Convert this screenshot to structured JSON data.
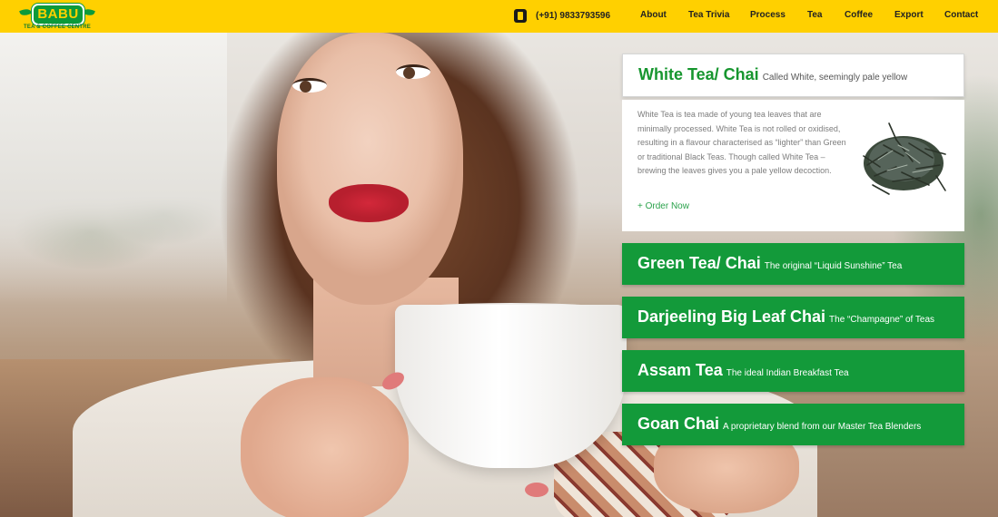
{
  "header": {
    "logo_text": "BABU",
    "logo_subtitle": "TEA & COFFEE CENTRE",
    "phone_icon": "phone-icon",
    "phone": "(+91) 9833793596",
    "nav": [
      "About",
      "Tea Trivia",
      "Process",
      "Tea",
      "Coffee",
      "Export",
      "Contact"
    ]
  },
  "colors": {
    "header_bg": "#ffd000",
    "brand_green": "#139a3a",
    "title_green": "#17962f"
  },
  "products": {
    "featured": {
      "title": "White Tea/ Chai",
      "subtitle": "Called White, seemingly pale yellow",
      "description": "White Tea is tea made of young tea leaves that are minimally processed. White Tea is not rolled or oxidised, resulting in a flavour characterised as “lighter” than Green or traditional Black Teas. Though called White Tea – brewing the leaves gives you a pale yellow decoction.",
      "order_label": "+ Order Now",
      "image_icon": "tea-leaves-image"
    },
    "others": [
      {
        "title": "Green Tea/ Chai",
        "subtitle": "The original “Liquid Sunshine” Tea"
      },
      {
        "title": "Darjeeling Big Leaf Chai",
        "subtitle": "The “Champagne” of Teas"
      },
      {
        "title": "Assam Tea",
        "subtitle": "The ideal Indian Breakfast Tea"
      },
      {
        "title": "Goan Chai",
        "subtitle": "A proprietary blend from our Master Tea Blenders"
      }
    ]
  }
}
